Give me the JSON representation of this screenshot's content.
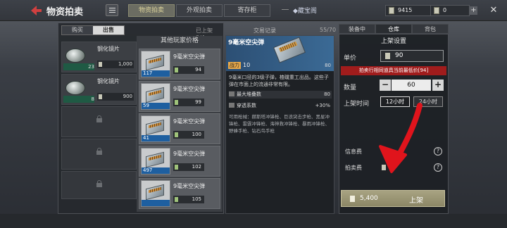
{
  "header": {
    "title": "物资拍卖",
    "tabs": [
      {
        "label": "物资拍卖",
        "active": true
      },
      {
        "label": "外观拍卖",
        "active": false
      },
      {
        "label": "寄存柜",
        "active": false
      }
    ],
    "help_link": "藏宝阁",
    "currencies": [
      {
        "icon": "banknote-icon",
        "value": "9415"
      },
      {
        "icon": "coupon-icon",
        "value": "0"
      }
    ]
  },
  "left": {
    "buy_label": "购买",
    "sell_label": "出售",
    "listed_count": "已上架 3/4",
    "my_slots": [
      {
        "name": "钢化镜片",
        "qty": "23",
        "price": "1,000"
      },
      {
        "name": "钢化镜片",
        "qty": "8",
        "price": "900"
      }
    ],
    "others_title": "其他玩家价格",
    "offers": [
      {
        "name": "9毫米空尖弹",
        "qty": "117",
        "price": "94"
      },
      {
        "name": "9毫米空尖弹",
        "qty": "59",
        "price": "99"
      },
      {
        "name": "9毫米空尖弹",
        "qty": "41",
        "price": "100"
      },
      {
        "name": "9毫米空尖弹",
        "qty": "497",
        "price": "102"
      },
      {
        "name": "9毫米空尖弹",
        "qty": "",
        "price": "105"
      }
    ]
  },
  "detail": {
    "tab_label": "交易记录",
    "count": "55/70",
    "name": "9毫米空尖弹",
    "power_tag": "战力",
    "power": "10",
    "small_value": "80",
    "description": "9毫米口径的3级子弹，楂磯重工出品。这些子弹在市面上的流通非常有限。",
    "stats": [
      {
        "label": "最大堆叠数",
        "value": "80"
      },
      {
        "label": "穿透系数",
        "value": "+30%"
      }
    ],
    "usable": "可用枪械：赫斯塔冲锋枪、巨浪突击步枪、黑星冲锋枪、雷霆冲锋枪、海神救冲锋枪、暴雨冲锋枪、野蜂手枪、钻石鸟手枪"
  },
  "right": {
    "tabs": [
      {
        "label": "装备中",
        "active": false
      },
      {
        "label": "仓库",
        "active": true
      },
      {
        "label": "背包",
        "active": false
      }
    ],
    "section_title": "上架设置",
    "unit_price_label": "单价",
    "unit_price": "90",
    "warning": "拍卖行相同道具当前最低价[94]",
    "quantity_label": "数量",
    "quantity": "60",
    "duration_label": "上架时间",
    "durations": [
      {
        "label": "12小时",
        "active": true
      },
      {
        "label": "24小时",
        "active": false
      }
    ],
    "info_fee_label": "信息费",
    "auction_fee_label": "拍卖费",
    "auction_fee_value": "5",
    "total": "5,400",
    "list_button": "上架"
  },
  "colors": {
    "warning": "#a01c1c",
    "annotation_arrow": "#e0141c",
    "offer_qty": "#1e5fa0",
    "detail_header": "#2c4f74"
  }
}
